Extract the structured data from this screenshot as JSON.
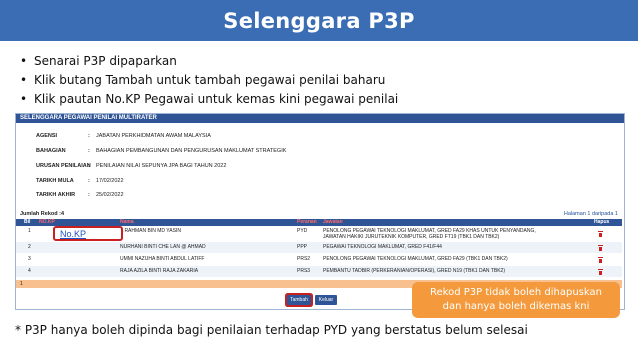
{
  "slide": {
    "title": "Selenggara P3P",
    "bullets": [
      "Senarai P3P dipaparkan",
      "Klik butang Tambah untuk tambah pegawai penilai baharu",
      "Klik pautan No.KP Pegawai untuk kemas kini pegawai penilai"
    ],
    "note": "Rekod P3P tidak boleh dihapuskan dan hanya boleh dikemas kni",
    "footnote": "* P3P hanya boleh dipinda bagi penilaian terhadap PYD yang berstatus belum selesai"
  },
  "app": {
    "header": "SELENGGARA PEGAWAI PENILAI MULTIRATER",
    "info": [
      {
        "label": "AGENSI",
        "value": "JABATAN PERKHIDMATAN AWAM MALAYSIA"
      },
      {
        "label": "BAHAGIAN",
        "value": "BAHAGIAN PEMBANGUNAN DAN PENGURUSAN MAKLUMAT STRATEGIK"
      },
      {
        "label": "URUSAN PENILAIAN",
        "value": "PENILAIAN NILAI SEPUNYA JPA BAGI TAHUN 2022"
      },
      {
        "label": "TARIKH MULA",
        "value": "17/02/2022"
      },
      {
        "label": "TARIKH AKHIR",
        "value": "25/02/2022"
      }
    ],
    "records_label": "Jumlah Rekod :4",
    "page_info": "Halaman 1 daripada 1",
    "columns": [
      "Bil",
      "NO.KP",
      "Nama",
      "Peranan",
      "Jawatan",
      "Hapus"
    ],
    "rows": [
      {
        "bil": "1",
        "nokp": "No.KP",
        "nama": "A RAHMAN BIN MD YASIN",
        "peranan": "PYD",
        "jawatan": [
          "PENOLONG PEGAWAI TEKNOLOGI MAKLUMAT, GRED FA29 KHAS UNTUK PENYANDANG,",
          "JAWATAN HAKIKI JURUTEKNIK KOMPUTER, GRED FT19 (TBK1 DAN TBK2)"
        ]
      },
      {
        "bil": "2",
        "nokp": "",
        "nama": "NURHANI BINTI CHE LAN @ AHMAD",
        "peranan": "PPP",
        "jawatan": [
          "PEGAWAI TEKNOLOGI MAKLUMAT, GRED F41/F44"
        ]
      },
      {
        "bil": "3",
        "nokp": "",
        "nama": "UMMI NAZUHA BINTI ABDUL LATIFF",
        "peranan": "PRS2",
        "jawatan": [
          "PENOLONG PEGAWAI TEKNOLOGI MAKLUMAT, GRED FA29 (TBK1 DAN TBK2)"
        ]
      },
      {
        "bil": "4",
        "nokp": "",
        "nama": "RAJA AZILA BINTI RAJA ZAKARIA",
        "peranan": "PRS3",
        "jawatan": [
          "PEMBANTU TADBIR (PERKERANIAN/OPERASI), GRED N19 (TBK1 DAN TBK2)"
        ]
      }
    ],
    "footer_row": "1",
    "buttons": {
      "tambah": "Tambah",
      "keluar": "Keluar"
    }
  },
  "colors": {
    "banner": "#3a6db3",
    "table_header": "#2f5597",
    "note": "#f49a3c",
    "highlight": "#c82020"
  }
}
